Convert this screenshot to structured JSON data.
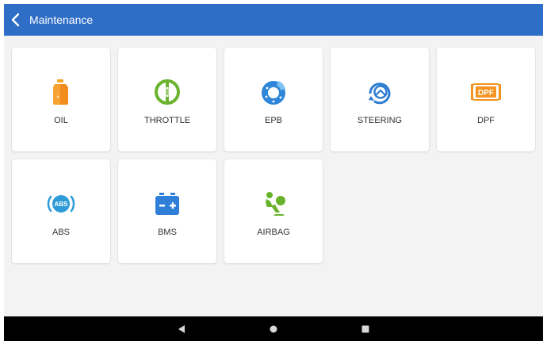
{
  "colors": {
    "appbar": "#2f6ec6",
    "background": "#f3f3f3",
    "card": "#ffffff",
    "navbar": "#000000"
  },
  "header": {
    "title": "Maintenance",
    "back_icon": "chevron-left-icon"
  },
  "tiles": [
    {
      "label": "OIL",
      "icon": "oil-bottle-icon"
    },
    {
      "label": "THROTTLE",
      "icon": "throttle-icon"
    },
    {
      "label": "EPB",
      "icon": "epb-icon"
    },
    {
      "label": "STEERING",
      "icon": "steering-icon"
    },
    {
      "label": "DPF",
      "icon": "dpf-icon"
    },
    {
      "label": "ABS",
      "icon": "abs-icon"
    },
    {
      "label": "BMS",
      "icon": "battery-icon"
    },
    {
      "label": "AIRBAG",
      "icon": "airbag-icon"
    }
  ],
  "icon_text": {
    "dpf": "DPF",
    "abs": "ABS"
  },
  "navbar": {
    "buttons": [
      "back-triangle-icon",
      "home-circle-icon",
      "recents-square-icon"
    ]
  }
}
